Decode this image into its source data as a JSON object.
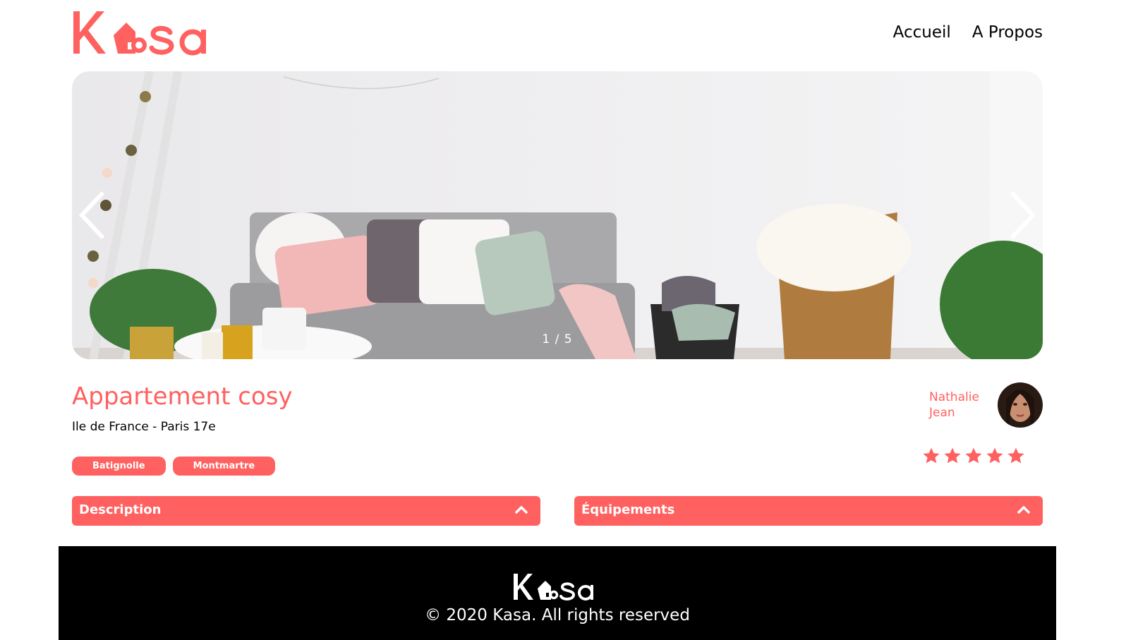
{
  "header": {
    "logo_text": "Kasa",
    "nav": {
      "home": "Accueil",
      "about": "A Propos"
    }
  },
  "carousel": {
    "counter": "1 / 5",
    "current": 1,
    "total": 5
  },
  "listing": {
    "title": "Appartement cosy",
    "location": "Ile de France - Paris 17e",
    "tags": [
      "Batignolle",
      "Montmartre"
    ],
    "host": {
      "first_name": "Nathalie",
      "last_name": "Jean"
    },
    "rating": 5,
    "rating_max": 5
  },
  "collapses": {
    "description": "Description",
    "equipments": "Équipements"
  },
  "footer": {
    "logo_text": "Kasa",
    "copyright": "© 2020 Kasa. All rights reserved"
  },
  "colors": {
    "brand": "#FF6060",
    "footer_bg": "#000000",
    "text": "#000000"
  },
  "icons": {
    "logo_house": "house-icon",
    "prev": "chevron-left-icon",
    "next": "chevron-right-icon",
    "collapse": "chevron-up-icon",
    "rating": "star-icon"
  }
}
